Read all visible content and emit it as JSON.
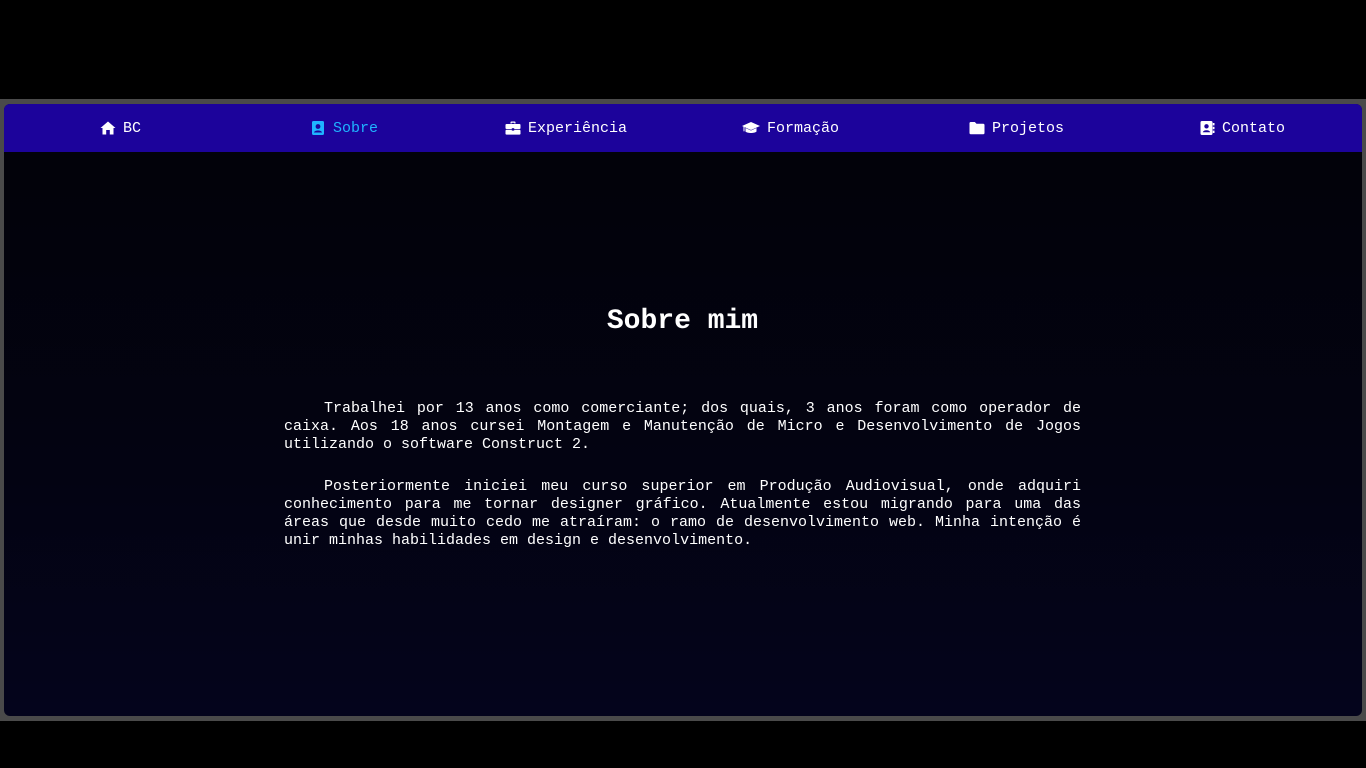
{
  "nav": {
    "items": [
      {
        "label": "BC",
        "icon": "home-icon",
        "active": false
      },
      {
        "label": "Sobre",
        "icon": "user-badge-icon",
        "active": true
      },
      {
        "label": "Experiência",
        "icon": "briefcase-icon",
        "active": false
      },
      {
        "label": "Formação",
        "icon": "graduation-cap-icon",
        "active": false
      },
      {
        "label": "Projetos",
        "icon": "folder-icon",
        "active": false
      },
      {
        "label": "Contato",
        "icon": "address-book-icon",
        "active": false
      }
    ]
  },
  "about": {
    "title": "Sobre mim",
    "paragraphs": [
      "Trabalhei por 13 anos como comerciante; dos quais, 3 anos foram como operador de caixa. Aos 18 anos cursei Montagem e Manutenção de Micro e Desenvolvimento de Jogos utilizando o software Construct 2.",
      "Posteriormente iniciei meu curso superior em Produção Audiovisual, onde adquiri conhecimento para me tornar designer gráfico. Atualmente estou migrando para uma das áreas que desde muito cedo me atraíram: o ramo de desenvolvimento web. Minha intenção é unir minhas habilidades em design e desenvolvimento."
    ]
  },
  "colors": {
    "navbar": "#1c039b",
    "active": "#1fb4ff",
    "text": "#ffffff",
    "background": "#000000"
  }
}
